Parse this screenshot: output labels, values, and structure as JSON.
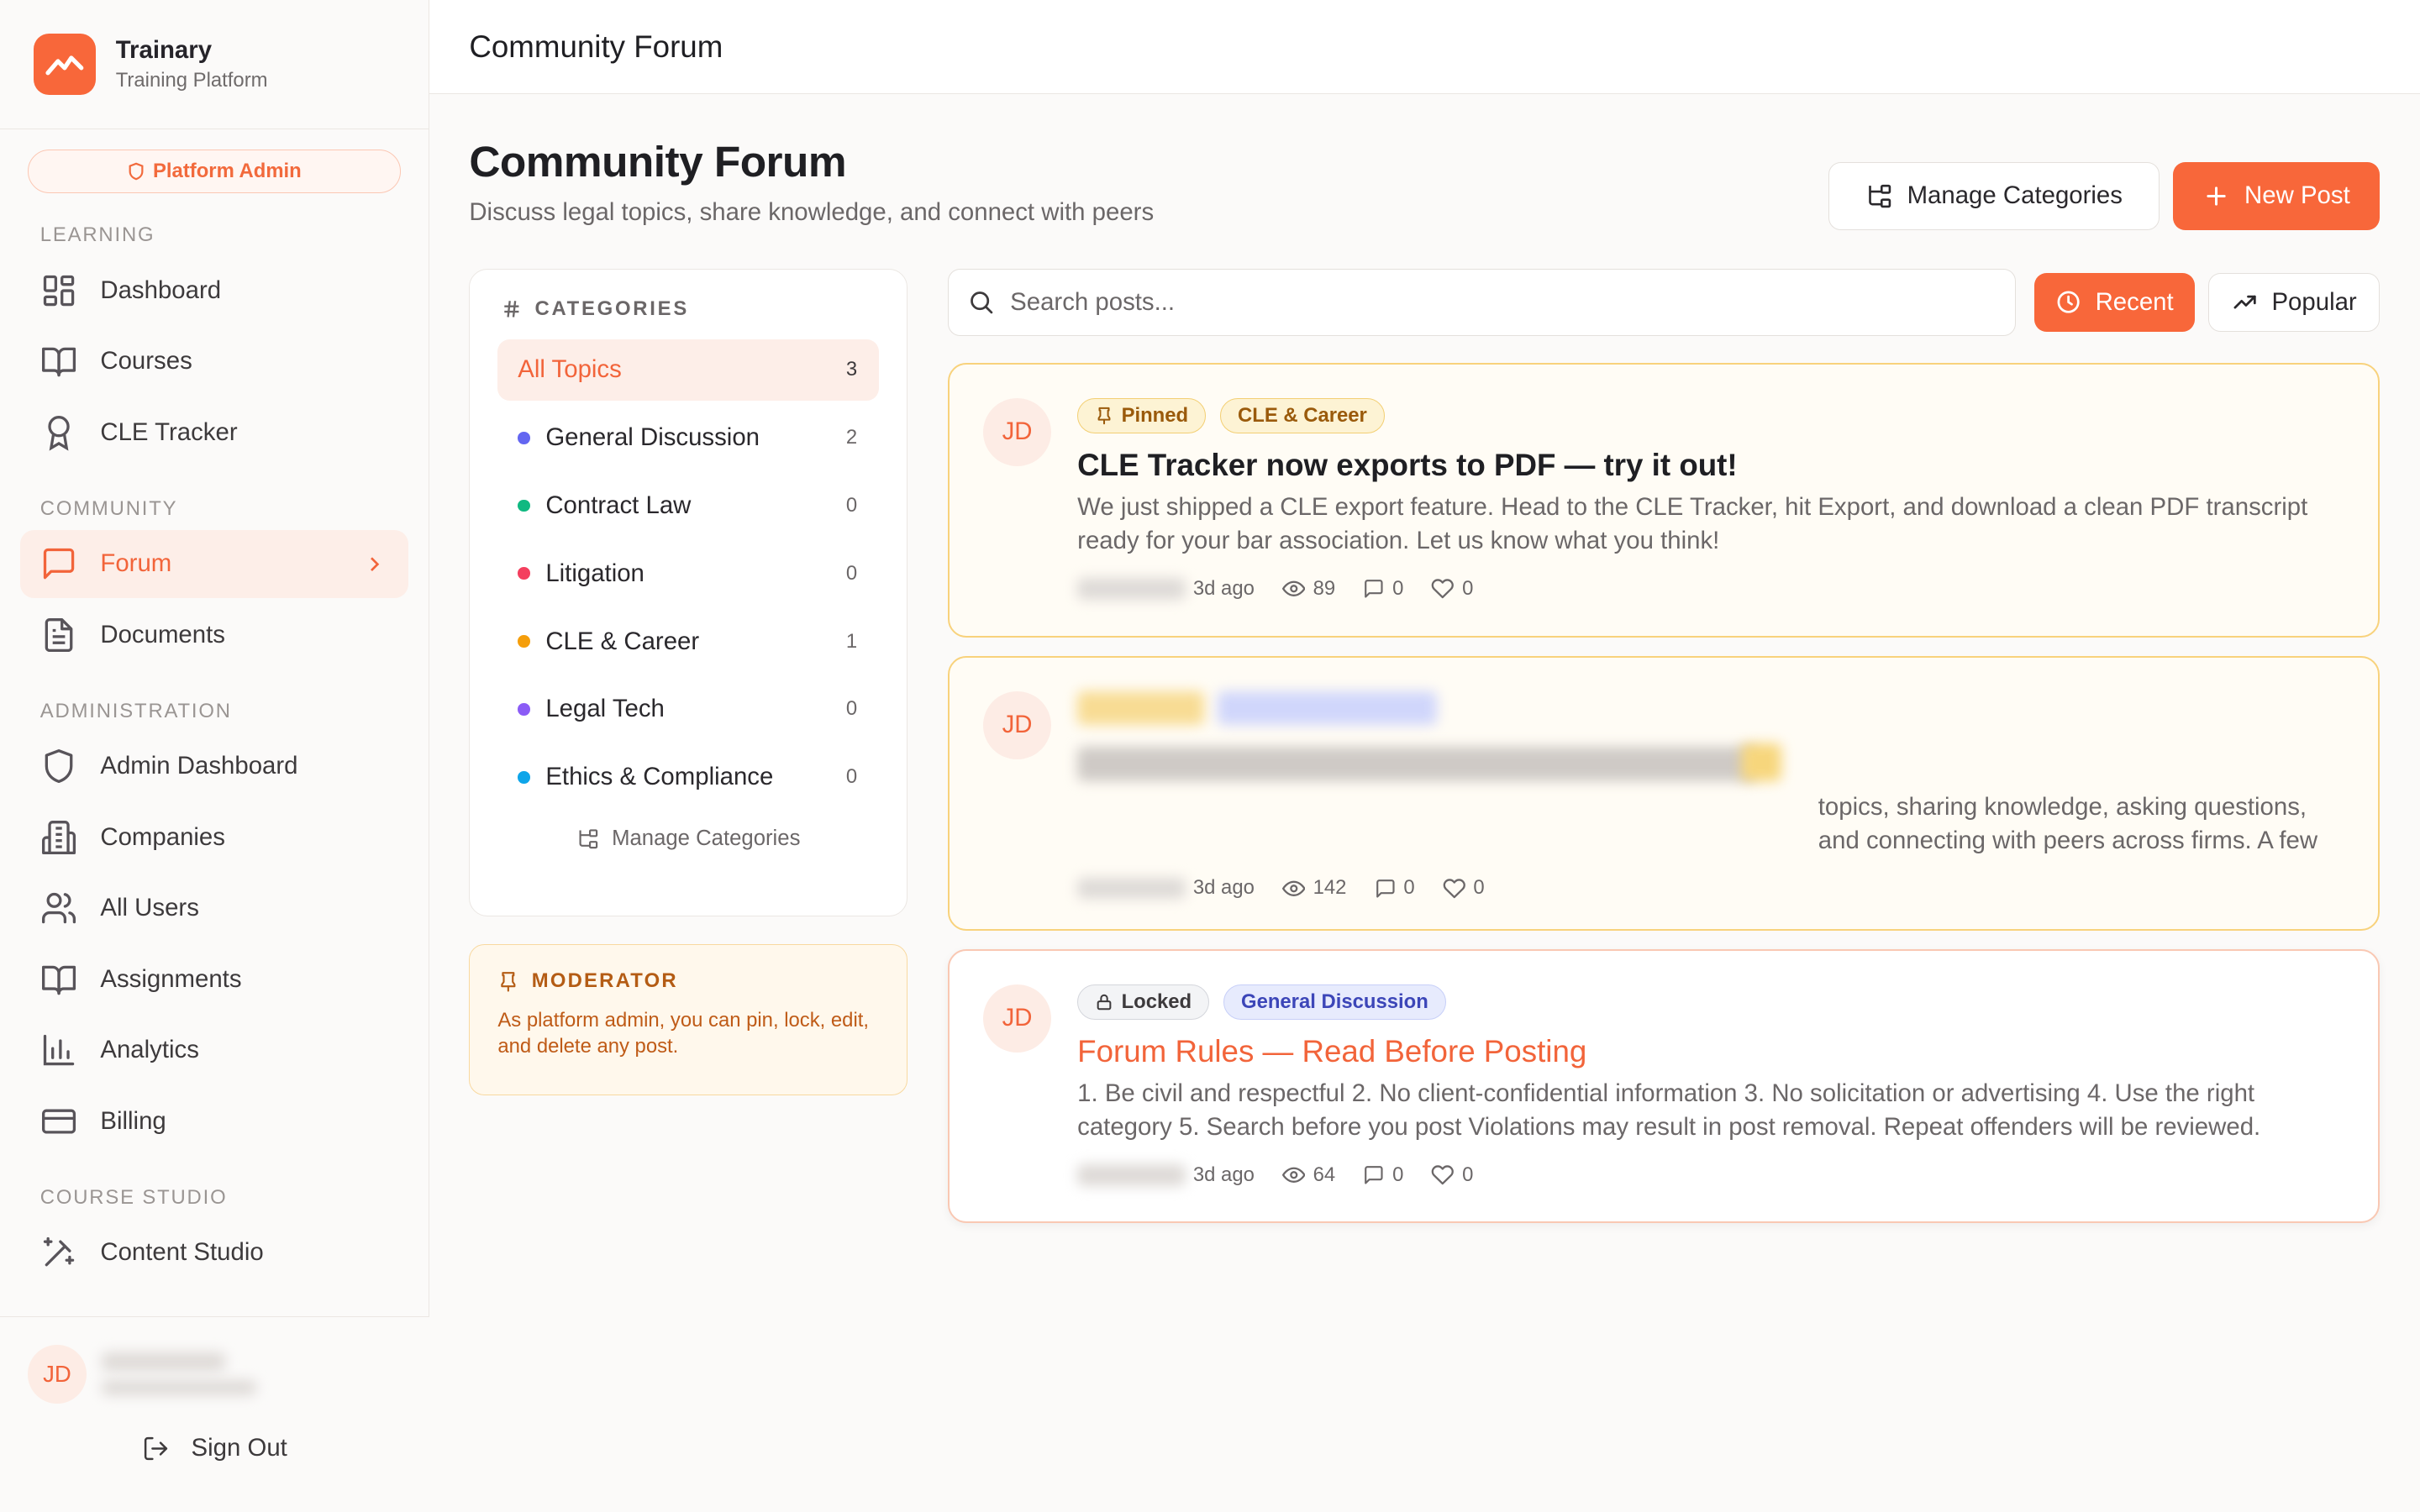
{
  "brand": {
    "name": "Trainary",
    "subtitle": "Training Platform"
  },
  "admin_badge": "Platform Admin",
  "nav": {
    "learning_label": "LEARNING",
    "learning": [
      {
        "label": "Dashboard",
        "icon": "layout-grid-icon"
      },
      {
        "label": "Courses",
        "icon": "book-open-icon"
      },
      {
        "label": "CLE Tracker",
        "icon": "award-icon"
      }
    ],
    "community_label": "COMMUNITY",
    "community": [
      {
        "label": "Forum",
        "icon": "message-square-icon",
        "active": true
      },
      {
        "label": "Documents",
        "icon": "file-text-icon"
      }
    ],
    "admin_label": "ADMINISTRATION",
    "admin": [
      {
        "label": "Admin Dashboard",
        "icon": "shield-icon"
      },
      {
        "label": "Companies",
        "icon": "building-icon"
      },
      {
        "label": "All Users",
        "icon": "users-icon"
      },
      {
        "label": "Assignments",
        "icon": "book-open-icon"
      },
      {
        "label": "Analytics",
        "icon": "bar-chart-icon"
      },
      {
        "label": "Billing",
        "icon": "credit-card-icon"
      }
    ],
    "studio_label": "COURSE STUDIO",
    "studio": [
      {
        "label": "Content Studio",
        "icon": "wand-icon"
      }
    ]
  },
  "user": {
    "initials": "JD",
    "sign_out": "Sign Out"
  },
  "topbar": {
    "title": "Community Forum"
  },
  "page": {
    "title": "Community Forum",
    "subtitle": "Discuss legal topics, share knowledge, and connect with peers",
    "manage_categories": "Manage Categories",
    "new_post": "New Post"
  },
  "categories": {
    "header": "CATEGORIES",
    "items": [
      {
        "label": "All Topics",
        "count": "3",
        "active": true
      },
      {
        "label": "General Discussion",
        "count": "2",
        "color": "#6366f1"
      },
      {
        "label": "Contract Law",
        "count": "0",
        "color": "#10b981"
      },
      {
        "label": "Litigation",
        "count": "0",
        "color": "#f43f5e"
      },
      {
        "label": "CLE & Career",
        "count": "1",
        "color": "#f59e0b"
      },
      {
        "label": "Legal Tech",
        "count": "0",
        "color": "#8b5cf6"
      },
      {
        "label": "Ethics & Compliance",
        "count": "0",
        "color": "#0ea5e9"
      }
    ],
    "manage": "Manage Categories"
  },
  "moderator": {
    "header": "MODERATOR",
    "text": "As platform admin, you can pin, lock, edit, and delete any post."
  },
  "search": {
    "placeholder": "Search posts..."
  },
  "sort": {
    "recent": "Recent",
    "popular": "Popular"
  },
  "posts": [
    {
      "initials": "JD",
      "tags": [
        "Pinned",
        "CLE & Career"
      ],
      "title": "CLE Tracker now exports to PDF — try it out!",
      "excerpt": "We just shipped a CLE export feature. Head to the CLE Tracker, hit Export, and download a clean PDF transcript ready for your bar association. Let us know what you think!",
      "age": "3d ago",
      "views": "89",
      "comments": "0",
      "likes": "0"
    },
    {
      "initials": "JD",
      "tags": [],
      "title": "",
      "excerpt": "topics, sharing knowledge, asking questions, and connecting with peers across firms. A few quick guidelines: • Be respectful and constructive • No client-…",
      "age": "3d ago",
      "views": "142",
      "comments": "0",
      "likes": "0"
    },
    {
      "initials": "JD",
      "tags": [
        "Locked",
        "General Discussion"
      ],
      "title": "Forum Rules — Read Before Posting",
      "excerpt": "1. Be civil and respectful 2. No client-confidential information 3. No solicitation or advertising 4. Use the right category 5. Search before you post Violations may result in post removal. Repeat offenders will be reviewed.",
      "age": "3d ago",
      "views": "64",
      "comments": "0",
      "likes": "0"
    }
  ],
  "colors": {
    "accent": "#f8673a",
    "pinned_border": "#f8d27c",
    "locked_border": "#f9c8b3"
  }
}
